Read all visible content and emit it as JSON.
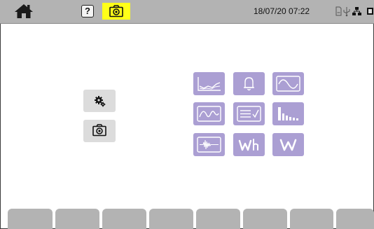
{
  "status_bar": {
    "datetime": "18/07/20 07:22",
    "icons": [
      "home-icon",
      "help-icon",
      "camera-icon",
      "sd-card-icon",
      "usb-icon",
      "network-icon",
      "battery-icon"
    ],
    "help_glyph": "?",
    "highlight_color": "#ffff18"
  },
  "left_buttons": [
    {
      "name": "configuration",
      "icon": "gears-icon"
    },
    {
      "name": "snapshots",
      "icon": "camera-icon"
    }
  ],
  "mode_tiles": [
    {
      "name": "trend",
      "icon": "trend-graph-icon"
    },
    {
      "name": "alarm",
      "icon": "bell-icon"
    },
    {
      "name": "waveform",
      "icon": "sine-wave-icon"
    },
    {
      "name": "inrush",
      "icon": "inrush-wave-icon"
    },
    {
      "name": "monitoring",
      "icon": "report-check-icon"
    },
    {
      "name": "harmonics",
      "icon": "harmonic-bars-icon"
    },
    {
      "name": "transient",
      "icon": "transient-icon"
    },
    {
      "name": "energy",
      "icon": "energy-wh-icon",
      "label": "Wh"
    },
    {
      "name": "power",
      "icon": "power-w-icon",
      "label": "W"
    }
  ],
  "bottom_tabs": 8,
  "colors": {
    "status_bar": "#b3b3b3",
    "tile": "#ab9fd3",
    "left_button": "#dcdcdc",
    "tab": "#b3b3b3"
  }
}
